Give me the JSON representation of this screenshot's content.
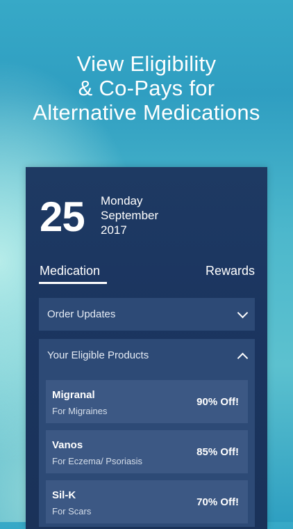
{
  "headline": {
    "line1": "View Eligibility",
    "line2": "& Co-Pays for",
    "line3": "Alternative Medications"
  },
  "date": {
    "day": "25",
    "weekday": "Monday",
    "month": "September",
    "year": "2017"
  },
  "tabs": [
    {
      "label": "Medication",
      "active": true
    },
    {
      "label": "Rewards",
      "active": false
    }
  ],
  "sections": {
    "order_updates": {
      "label": "Order Updates",
      "expanded": false,
      "icon": "chevron-down-icon"
    },
    "eligible_products": {
      "label": "Your Eligible Products",
      "expanded": true,
      "icon": "chevron-up-icon"
    }
  },
  "products": [
    {
      "name": "Migranal",
      "description": "For Migraines",
      "discount": "90% Off!"
    },
    {
      "name": "Vanos",
      "description": "For Eczema/ Psoriasis",
      "discount": "85% Off!"
    },
    {
      "name": "Sil-K",
      "description": "For Scars",
      "discount": "70% Off!"
    }
  ],
  "colors": {
    "card_background": "#1b3560",
    "accordion_background": "#2d4a76",
    "product_background": "#3c5884",
    "text": "#ffffff"
  }
}
